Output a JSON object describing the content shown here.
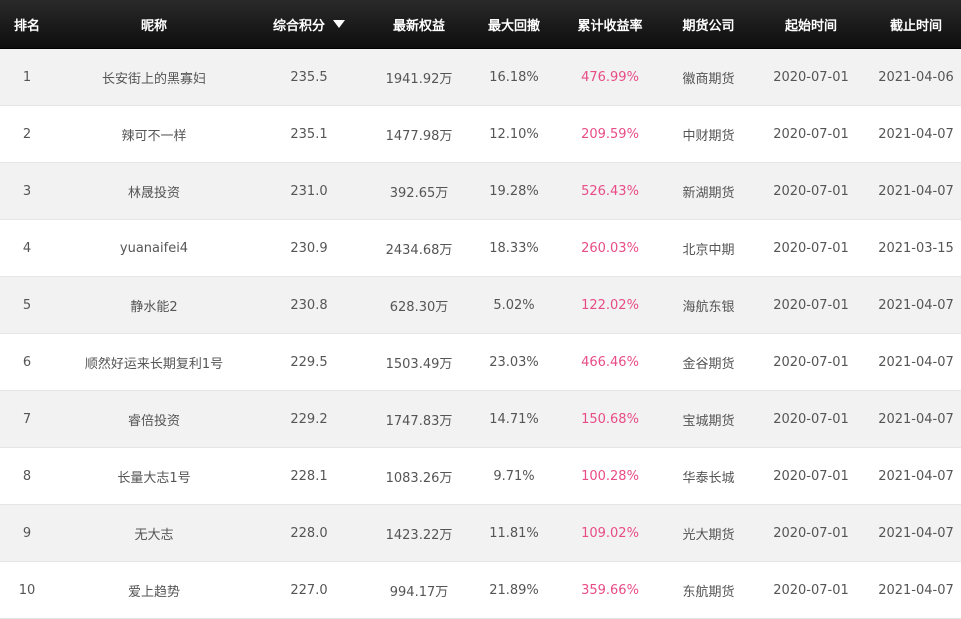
{
  "header": {
    "rank": "排名",
    "nickname": "昵称",
    "score": "综合积分",
    "equity": "最新权益",
    "drawdown": "最大回撤",
    "return_rate": "累计收益率",
    "broker": "期货公司",
    "start": "起始时间",
    "end": "截止时间"
  },
  "rows": [
    {
      "rank": "1",
      "nickname": "长安街上的黑寡妇",
      "score": "235.5",
      "equity": "1941.92万",
      "drawdown": "16.18%",
      "return_rate": "476.99%",
      "broker": "徽商期货",
      "start": "2020-07-01",
      "end": "2021-04-06"
    },
    {
      "rank": "2",
      "nickname": "辣可不一样",
      "score": "235.1",
      "equity": "1477.98万",
      "drawdown": "12.10%",
      "return_rate": "209.59%",
      "broker": "中财期货",
      "start": "2020-07-01",
      "end": "2021-04-07"
    },
    {
      "rank": "3",
      "nickname": "林晟投资",
      "score": "231.0",
      "equity": "392.65万",
      "drawdown": "19.28%",
      "return_rate": "526.43%",
      "broker": "新湖期货",
      "start": "2020-07-01",
      "end": "2021-04-07"
    },
    {
      "rank": "4",
      "nickname": "yuanaifei4",
      "score": "230.9",
      "equity": "2434.68万",
      "drawdown": "18.33%",
      "return_rate": "260.03%",
      "broker": "北京中期",
      "start": "2020-07-01",
      "end": "2021-03-15"
    },
    {
      "rank": "5",
      "nickname": "静水能2",
      "score": "230.8",
      "equity": "628.30万",
      "drawdown": "5.02%",
      "return_rate": "122.02%",
      "broker": "海航东银",
      "start": "2020-07-01",
      "end": "2021-04-07"
    },
    {
      "rank": "6",
      "nickname": "顺然好运来长期复利1号",
      "score": "229.5",
      "equity": "1503.49万",
      "drawdown": "23.03%",
      "return_rate": "466.46%",
      "broker": "金谷期货",
      "start": "2020-07-01",
      "end": "2021-04-07"
    },
    {
      "rank": "7",
      "nickname": "睿倍投资",
      "score": "229.2",
      "equity": "1747.83万",
      "drawdown": "14.71%",
      "return_rate": "150.68%",
      "broker": "宝城期货",
      "start": "2020-07-01",
      "end": "2021-04-07"
    },
    {
      "rank": "8",
      "nickname": "长量大志1号",
      "score": "228.1",
      "equity": "1083.26万",
      "drawdown": "9.71%",
      "return_rate": "100.28%",
      "broker": "华泰长城",
      "start": "2020-07-01",
      "end": "2021-04-07"
    },
    {
      "rank": "9",
      "nickname": "无大志",
      "score": "228.0",
      "equity": "1423.22万",
      "drawdown": "11.81%",
      "return_rate": "109.02%",
      "broker": "光大期货",
      "start": "2020-07-01",
      "end": "2021-04-07"
    },
    {
      "rank": "10",
      "nickname": "爱上趋势",
      "score": "227.0",
      "equity": "994.17万",
      "drawdown": "21.89%",
      "return_rate": "359.66%",
      "broker": "东航期货",
      "start": "2020-07-01",
      "end": "2021-04-07"
    }
  ],
  "sort": {
    "column": "score",
    "direction": "desc",
    "icon": "sort-down-icon"
  },
  "colors": {
    "header_bg": "#1a1a1a",
    "return_rate": "#e84c86",
    "row_alt": "#f2f2f2"
  }
}
